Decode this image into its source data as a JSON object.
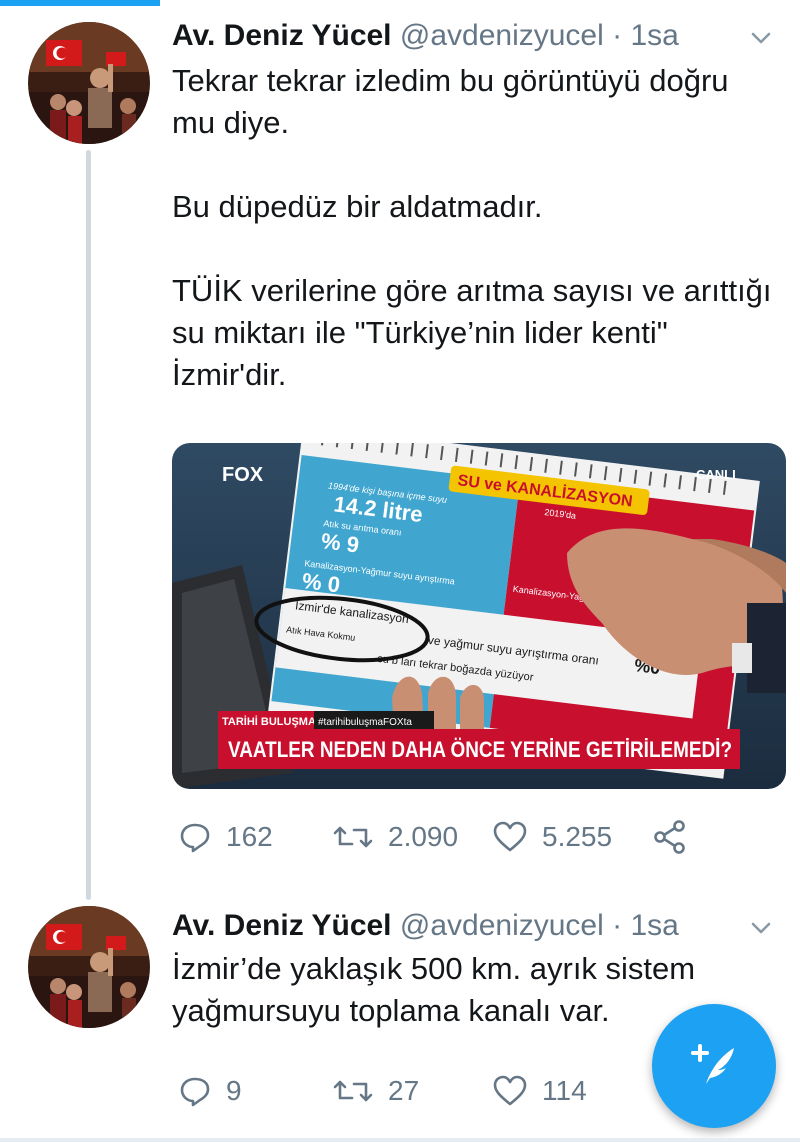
{
  "tweets": [
    {
      "name": "Av. Deniz Yücel",
      "handle": "@avdenizyucel",
      "separator": "·",
      "time": "1sa",
      "paragraphs": [
        "Tekrar tekrar izledim bu görüntüyü doğru mu diye.",
        "Bu düpedüz bir aldatmadır.",
        "TÜİK verilerine göre arıtma sayısı ve arıttığı su miktarı ile \"Türkiye’nin lider kenti\" İzmir'dir."
      ],
      "media": {
        "channel_logo": "FOX",
        "live_label": "CANLI",
        "card_banner": "SU ve KANALİZASYON",
        "card_left_lines": [
          "1994'de kişi başına içme suyu",
          "14.2 litre",
          "Atık su arıtma oranı",
          "% 9",
          "Kanalizasyon-Yağmur suyu ayrıştırma",
          "% 0"
        ],
        "card_right_top": "2019'da",
        "card_right_mid": "Kanalizasyon-Yağ",
        "card_right_pct": "%",
        "circled_text": "İzmir'de kanalizasyon",
        "bottom_line_1": "ve yağmur suyu ayrıştırma oranı",
        "bottom_pct": "%0",
        "bottom_line_2a": "Atık Hava Kokmu",
        "bottom_line_2b": "su b    ları tekrar boğazda yüzüyor",
        "ticker_label": "TARİHİ BULUŞMA",
        "ticker_hashtag": "#tarihibuluşmaFOXta",
        "headline": "VAATLER NEDEN DAHA ÖNCE YERİNE GETİRİLEMEDİ?"
      },
      "replies": "162",
      "retweets": "2.090",
      "likes": "5.255"
    },
    {
      "name": "Av. Deniz Yücel",
      "handle": "@avdenizyucel",
      "separator": "·",
      "time": "1sa",
      "paragraphs": [
        "İzmir’de yaklaşık 500 km. ayrık sistem yağmursuyu toplama kanalı var."
      ],
      "replies": "9",
      "retweets": "27",
      "likes": "114"
    }
  ],
  "icons": {
    "reply": "reply-icon",
    "retweet": "retweet-icon",
    "like": "heart-icon",
    "share": "share-icon",
    "chevron": "chevron-down-icon",
    "compose": "compose-tweet-icon"
  },
  "colors": {
    "accent": "#1da1f2",
    "secondary_text": "#657786",
    "headline_red": "#c8102e"
  }
}
